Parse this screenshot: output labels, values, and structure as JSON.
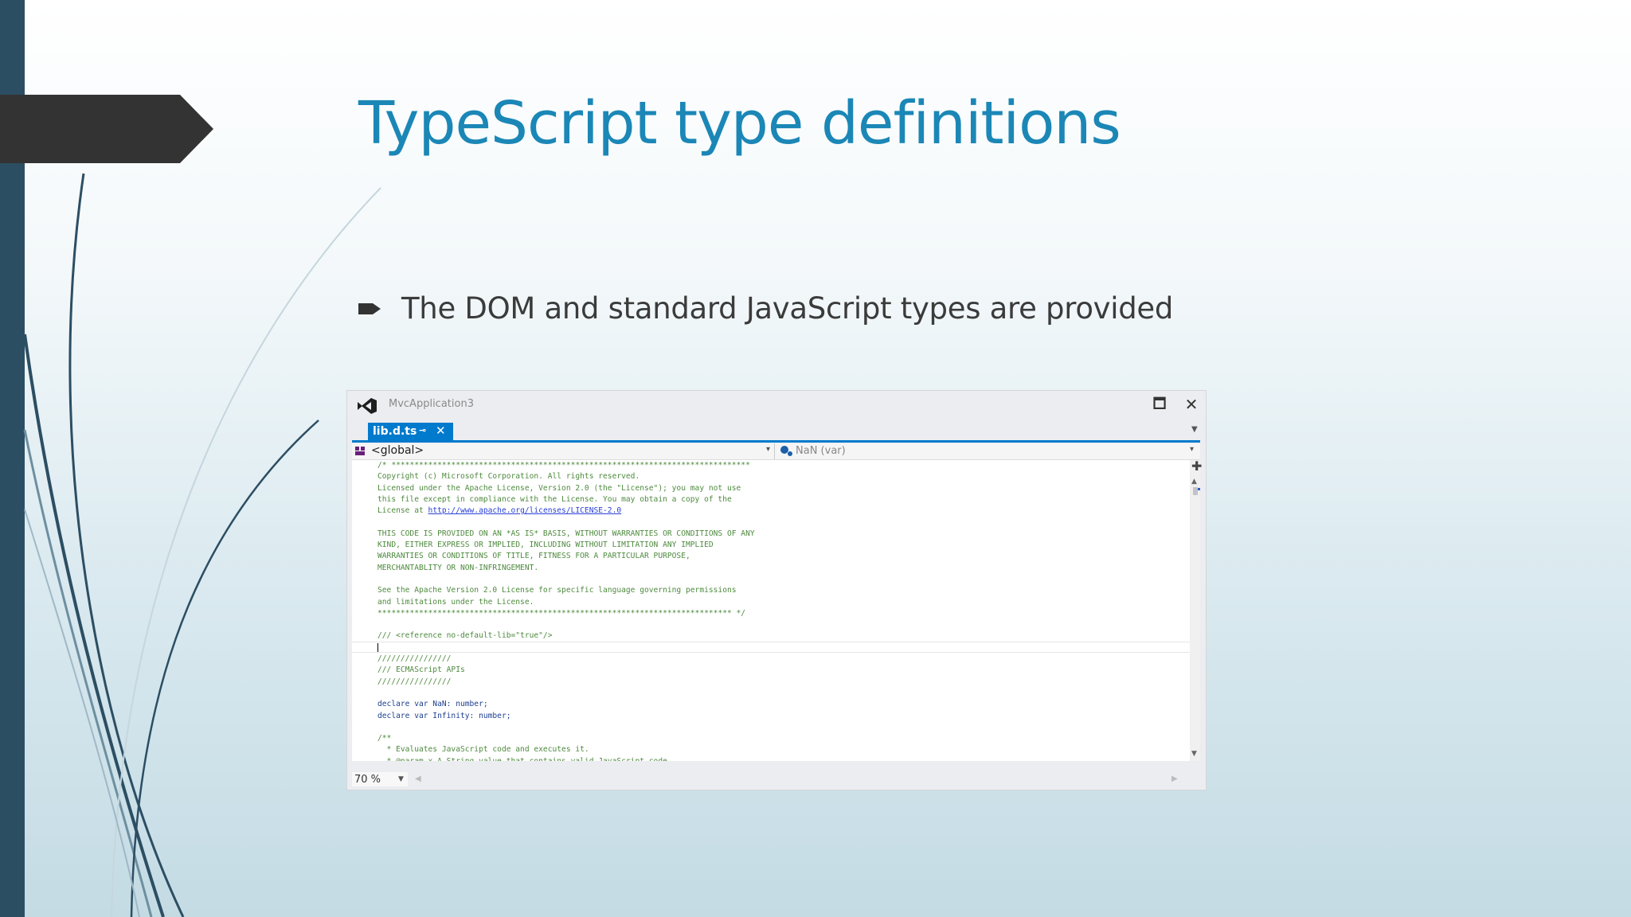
{
  "slide": {
    "title": "TypeScript type definitions",
    "bullet": "The DOM and standard JavaScript types are provided"
  },
  "ide": {
    "app_title": "MvcApplication3",
    "tab_label": "lib.d.ts",
    "tab_pin": "⊸",
    "tab_close": "✕",
    "maximize": "🗖",
    "close": "✕",
    "nav_scope": "<global>",
    "nav_member": "NaN (var)",
    "zoom": "70 %",
    "accent_color": "#007acc",
    "code": [
      {
        "text": "/* ****************************************************************************** ",
        "style": "comment"
      },
      {
        "text": "Copyright (c) Microsoft Corporation. All rights reserved.",
        "style": "comment"
      },
      {
        "text": "Licensed under the Apache License, Version 2.0 (the \"License\"); you may not use",
        "style": "comment"
      },
      {
        "text": "this file except in compliance with the License. You may obtain a copy of the",
        "style": "comment"
      },
      {
        "text": "License at ",
        "link": "http://www.apache.org/licenses/LICENSE-2.0",
        "style": "comment"
      },
      {
        "text": "",
        "style": "comment"
      },
      {
        "text": "THIS CODE IS PROVIDED ON AN *AS IS* BASIS, WITHOUT WARRANTIES OR CONDITIONS OF ANY",
        "style": "comment"
      },
      {
        "text": "KIND, EITHER EXPRESS OR IMPLIED, INCLUDING WITHOUT LIMITATION ANY IMPLIED",
        "style": "comment"
      },
      {
        "text": "WARRANTIES OR CONDITIONS OF TITLE, FITNESS FOR A PARTICULAR PURPOSE,",
        "style": "comment"
      },
      {
        "text": "MERCHANTABLITY OR NON-INFRINGEMENT.",
        "style": "comment"
      },
      {
        "text": "",
        "style": "comment"
      },
      {
        "text": "See the Apache Version 2.0 License for specific language governing permissions",
        "style": "comment"
      },
      {
        "text": "and limitations under the License.",
        "style": "comment"
      },
      {
        "text": "***************************************************************************** */",
        "style": "comment"
      },
      {
        "text": "",
        "style": "comment"
      },
      {
        "text": "/// <reference no-default-lib=\"true\"/>",
        "style": "comment"
      },
      {
        "text": "",
        "style": "comment"
      },
      {
        "text": "////////////////",
        "style": "comment"
      },
      {
        "text": "/// ECMAScript APIs",
        "style": "comment"
      },
      {
        "text": "////////////////",
        "style": "comment"
      },
      {
        "text": "",
        "style": "comment"
      },
      {
        "text": "declare var NaN: number;",
        "style": "keyword"
      },
      {
        "text": "declare var Infinity: number;",
        "style": "keyword"
      },
      {
        "text": "",
        "style": "comment"
      },
      {
        "text": "/**",
        "style": "comment"
      },
      {
        "text": "  * Evaluates JavaScript code and executes it.",
        "style": "comment"
      },
      {
        "text": "  * @param x A String value that contains valid JavaScript code.",
        "style": "comment"
      }
    ]
  }
}
